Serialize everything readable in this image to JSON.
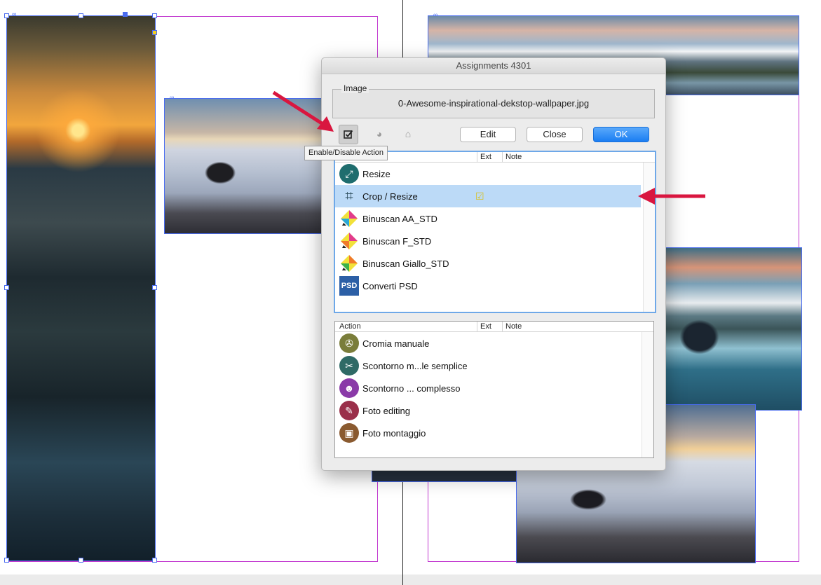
{
  "dialog": {
    "title": "Assignments 4301",
    "group_label": "Image",
    "filename": "0-Awesome-inspirational-dekstop-wallpaper.jpg",
    "buttons": {
      "edit": "Edit",
      "close": "Close",
      "ok": "OK"
    },
    "tooltip": "Enable/Disable Action",
    "columns": {
      "action": "Action",
      "ext": "Ext",
      "note": "Note"
    },
    "assigned_actions": [
      {
        "label": "Resize",
        "icon": "resize-icon",
        "color": "#1f6d6e"
      },
      {
        "label": "Crop / Resize",
        "icon": "crop-icon",
        "color": "#2f4f5e",
        "ext_enabled": true,
        "selected": true
      },
      {
        "label": "Binuscan AA_STD",
        "icon": "binuscan-icon"
      },
      {
        "label": "Binuscan F_STD",
        "icon": "binuscan-icon"
      },
      {
        "label": "Binuscan Giallo_STD",
        "icon": "binuscan-icon"
      },
      {
        "label": "Converti PSD",
        "icon": "psd-icon",
        "icon_text": "PSD"
      }
    ],
    "available_actions": [
      {
        "label": "Cromia manuale",
        "icon": "film-reel-icon",
        "color": "#7a7d3a"
      },
      {
        "label": "Scontorno m...le semplice",
        "icon": "scissors-icon",
        "color": "#2f6a66"
      },
      {
        "label": "Scontorno ... complesso",
        "icon": "people-icon",
        "color": "#8a3aa8"
      },
      {
        "label": "Foto editing",
        "icon": "pencil-icon",
        "color": "#9a2f4a"
      },
      {
        "label": "Foto montaggio",
        "icon": "photos-icon",
        "color": "#8a5a30"
      }
    ]
  },
  "colors": {
    "accent": "#1a7df2",
    "selection": "#bcdaf7",
    "annotation_arrow": "#d9163f"
  }
}
